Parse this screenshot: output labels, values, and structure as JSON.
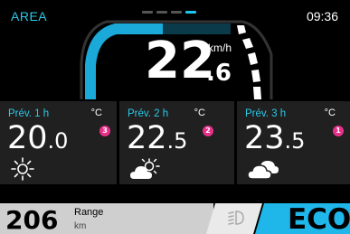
{
  "header": {
    "title": "AREA",
    "clock": "09:36"
  },
  "pager": {
    "active_page": 4,
    "page_count": 4
  },
  "speed": {
    "integer": "22",
    "decimal": ".6",
    "unit": "km/h"
  },
  "forecast": [
    {
      "label": "Prév. 1 h",
      "unit": "°C",
      "badge": "3",
      "temp_int": "20",
      "temp_dec": ".0",
      "icon": "sun-icon"
    },
    {
      "label": "Prév. 2 h",
      "unit": "°C",
      "badge": "2",
      "temp_int": "22",
      "temp_dec": ".5",
      "icon": "partly-cloudy-icon"
    },
    {
      "label": "Prév. 3 h",
      "unit": "°C",
      "badge": "1",
      "temp_int": "23",
      "temp_dec": ".5",
      "icon": "cloud-icon"
    }
  ],
  "footer": {
    "range_value": "206",
    "range_label": "Range",
    "range_unit": "km",
    "light_icon": "headlight-icon",
    "mode": "ECO"
  },
  "colors": {
    "accent": "#2bc9e8",
    "mode_bg": "#1fb7ea",
    "badge": "#e8308a",
    "card_bg": "#202020"
  }
}
